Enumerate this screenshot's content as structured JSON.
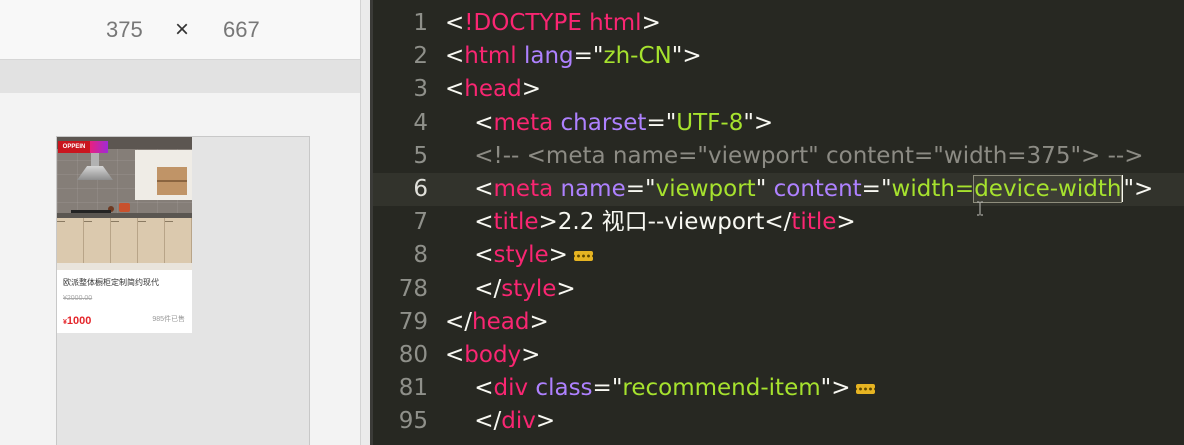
{
  "device_toolbar": {
    "dim1": "375",
    "sep": "×",
    "dim2": "667"
  },
  "product_card": {
    "brand_logo": "OPPEIN",
    "title": "欧派整体橱柜定制简约现代",
    "original_price": "¥2000.00",
    "currency": "¥",
    "price": "1000",
    "sold": "985件已售"
  },
  "editor": {
    "current_line": "6",
    "lines": [
      {
        "n": "1",
        "tokens": [
          {
            "t": "<",
            "k": "punct"
          },
          {
            "t": "!DOCTYPE html",
            "k": "tag"
          },
          {
            "t": ">",
            "k": "punct"
          }
        ]
      },
      {
        "n": "2",
        "tokens": [
          {
            "t": "<",
            "k": "punct"
          },
          {
            "t": "html",
            "k": "tag"
          },
          {
            "t": " lang",
            "k": "attr"
          },
          {
            "t": "=\"",
            "k": "punct"
          },
          {
            "t": "zh-CN",
            "k": "string"
          },
          {
            "t": "\">",
            "k": "punct"
          }
        ]
      },
      {
        "n": "3",
        "tokens": [
          {
            "t": "<",
            "k": "punct"
          },
          {
            "t": "head",
            "k": "tag"
          },
          {
            "t": ">",
            "k": "punct"
          }
        ]
      },
      {
        "n": "4",
        "tokens": [
          {
            "t": "    <",
            "k": "punct"
          },
          {
            "t": "meta",
            "k": "tag"
          },
          {
            "t": " charset",
            "k": "attr"
          },
          {
            "t": "=\"",
            "k": "punct"
          },
          {
            "t": "UTF-8",
            "k": "string"
          },
          {
            "t": "\">",
            "k": "punct"
          }
        ]
      },
      {
        "n": "5",
        "tokens": [
          {
            "t": "    <!-- <meta name=\"viewport\" content=\"width=375\"> -->",
            "k": "comment"
          }
        ]
      },
      {
        "n": "6",
        "tokens": [
          {
            "t": "    <",
            "k": "punct"
          },
          {
            "t": "meta",
            "k": "tag"
          },
          {
            "t": " name",
            "k": "attr"
          },
          {
            "t": "=\"",
            "k": "punct"
          },
          {
            "t": "viewport",
            "k": "string"
          },
          {
            "t": "\"",
            "k": "punct"
          },
          {
            "t": " content",
            "k": "attr"
          },
          {
            "t": "=\"",
            "k": "punct"
          },
          {
            "t": "width=",
            "k": "string"
          },
          {
            "t": "device-width",
            "k": "string",
            "selected": true
          },
          {
            "k": "caret"
          },
          {
            "t": "\">",
            "k": "punct"
          }
        ]
      },
      {
        "n": "7",
        "tokens": [
          {
            "t": "    <",
            "k": "punct"
          },
          {
            "t": "title",
            "k": "tag"
          },
          {
            "t": ">",
            "k": "punct"
          },
          {
            "t": "2.2 视口--viewport",
            "k": "text"
          },
          {
            "t": "</",
            "k": "punct"
          },
          {
            "t": "title",
            "k": "tag"
          },
          {
            "t": ">",
            "k": "punct"
          }
        ]
      },
      {
        "n": "8",
        "tokens": [
          {
            "t": "    <",
            "k": "punct"
          },
          {
            "t": "style",
            "k": "tag"
          },
          {
            "t": ">",
            "k": "punct"
          },
          {
            "k": "fold"
          }
        ]
      },
      {
        "n": "78",
        "tokens": [
          {
            "t": "    </",
            "k": "punct"
          },
          {
            "t": "style",
            "k": "tag"
          },
          {
            "t": ">",
            "k": "punct"
          }
        ]
      },
      {
        "n": "79",
        "tokens": [
          {
            "t": "</",
            "k": "punct"
          },
          {
            "t": "head",
            "k": "tag"
          },
          {
            "t": ">",
            "k": "punct"
          }
        ]
      },
      {
        "n": "80",
        "tokens": [
          {
            "t": "<",
            "k": "punct"
          },
          {
            "t": "body",
            "k": "tag"
          },
          {
            "t": ">",
            "k": "punct"
          }
        ]
      },
      {
        "n": "81",
        "tokens": [
          {
            "t": "    <",
            "k": "punct"
          },
          {
            "t": "div",
            "k": "tag"
          },
          {
            "t": " class",
            "k": "attr"
          },
          {
            "t": "=\"",
            "k": "punct"
          },
          {
            "t": "recommend-item",
            "k": "string"
          },
          {
            "t": "\">",
            "k": "punct"
          },
          {
            "k": "fold"
          }
        ]
      },
      {
        "n": "95",
        "tokens": [
          {
            "t": "    </",
            "k": "punct"
          },
          {
            "t": "div",
            "k": "tag"
          },
          {
            "t": ">",
            "k": "punct"
          }
        ]
      }
    ]
  },
  "colors": {
    "editor_bg": "#272822",
    "tag": "#f92672",
    "attr": "#ae81ff",
    "string": "#a6e22e",
    "punct": "#f8f8f2",
    "text": "#f8f8f2",
    "comment": "#8c8b84",
    "fold": "#e6b422",
    "price": "#e4262b",
    "brand": "#c9151e"
  }
}
